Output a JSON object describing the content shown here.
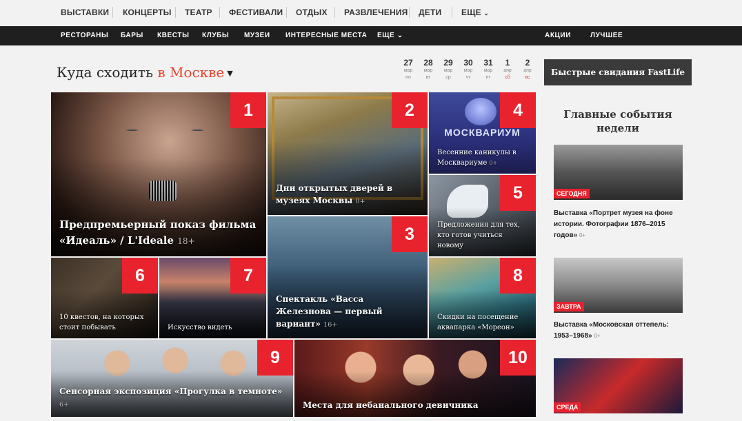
{
  "topnav": {
    "items": [
      "ВЫСТАВКИ",
      "КОНЦЕРТЫ",
      "ТЕАТР",
      "ФЕСТИВАЛИ",
      "ОТДЫХ",
      "РАЗВЛЕЧЕНИЯ",
      "ДЕТИ",
      "ЕЩЕ"
    ]
  },
  "subnav": {
    "left": [
      "РЕСТОРАНЫ",
      "БАРЫ",
      "КВЕСТЫ",
      "КЛУБЫ",
      "МУЗЕИ",
      "ИНТЕРЕСНЫЕ МЕСТА",
      "ЕЩЕ"
    ],
    "right": [
      "АКЦИИ",
      "ЛУЧШЕЕ"
    ]
  },
  "heading": {
    "prefix": "Куда сходить",
    "city": "в Москве"
  },
  "dates": [
    {
      "num": "27",
      "mon": "мар",
      "dow": "пн"
    },
    {
      "num": "28",
      "mon": "мар",
      "dow": "вт"
    },
    {
      "num": "29",
      "mon": "мар",
      "dow": "ср"
    },
    {
      "num": "30",
      "mon": "мар",
      "dow": "чт"
    },
    {
      "num": "31",
      "mon": "мар",
      "dow": "пт"
    },
    {
      "num": "1",
      "mon": "апр",
      "dow": "сб"
    },
    {
      "num": "2",
      "mon": "апр",
      "dow": "вс"
    }
  ],
  "promo": "Быстрые свидания FastLife",
  "tiles": [
    {
      "n": "1",
      "title": "Предпремьерный показ фильма «Идеаль» / L'Ideale",
      "age": "18+"
    },
    {
      "n": "2",
      "title": "Дни открытых дверей в музеях Москвы",
      "age": "0+"
    },
    {
      "n": "3",
      "title": "Спектакль «Васса Железнова — первый вариант»",
      "age": "16+"
    },
    {
      "n": "4",
      "title": "Весенние каникулы в Москвариуме",
      "age": "0+",
      "logo": "МОСКВАРИУМ"
    },
    {
      "n": "5",
      "title": "Предложения для тех, кто готов учиться новому",
      "age": ""
    },
    {
      "n": "6",
      "title": "10 квестов, на которых стоит побывать",
      "age": ""
    },
    {
      "n": "7",
      "title": "Искусство видеть",
      "age": ""
    },
    {
      "n": "8",
      "title": "Скидки на посещение аквапарка «Мореон»",
      "age": ""
    },
    {
      "n": "9",
      "title": "Сенсорная экспозиция «Прогулка в темноте»",
      "age": "6+"
    },
    {
      "n": "10",
      "title": "Места для небанального девичника",
      "age": ""
    }
  ],
  "sidebar": {
    "title": "Главные события недели",
    "cards": [
      {
        "tag": "СЕГОДНЯ",
        "text": "Выставка «Портрет музея на фоне истории. Фотографии 1876–2015 годов»",
        "age": "0+"
      },
      {
        "tag": "ЗАВТРА",
        "text": "Выставка «Московская оттепель: 1953–1968»",
        "age": "0+"
      },
      {
        "tag": "СРЕДА",
        "text": "",
        "age": ""
      }
    ]
  },
  "colors": {
    "accent": "#e8232e",
    "city": "#e8432e",
    "subnav_bg": "#1f1f1f"
  }
}
